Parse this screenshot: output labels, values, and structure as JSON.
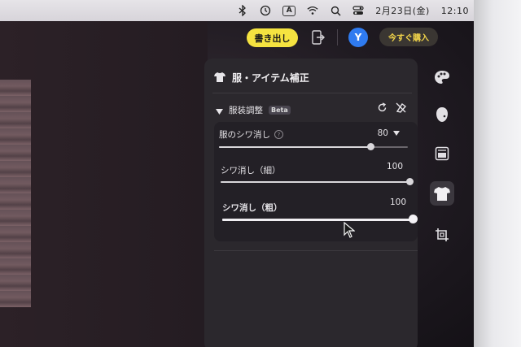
{
  "menubar": {
    "date": "2月23日(金)",
    "time": "12:10",
    "icons": [
      "bluetooth-icon",
      "time-machine-icon",
      "input-source-icon",
      "wifi-icon",
      "search-icon",
      "control-center-icon"
    ],
    "input_source_label": "A"
  },
  "toolbar": {
    "export_label": "書き出し",
    "avatar_letter": "Y",
    "buy_label": "今すぐ購入",
    "accent": "#f5e340",
    "avatar_color": "#2f7bf0"
  },
  "panel": {
    "title": "服・アイテム補正",
    "section": {
      "title": "服装調整",
      "badge": "Beta"
    },
    "sliders": [
      {
        "label": "服のシワ消し",
        "value": "80",
        "has_help": true,
        "has_dropdown": true,
        "fraction": 0.8
      },
      {
        "label": "シワ消し（細）",
        "value": "100",
        "fraction": 1.0
      },
      {
        "label": "シワ消し（粗）",
        "value": "100",
        "fraction": 1.0
      }
    ]
  },
  "rail": {
    "items": [
      "palette-icon",
      "face-retouch-icon",
      "background-icon",
      "clothing-icon",
      "crop-icon"
    ],
    "active": "clothing-icon"
  }
}
